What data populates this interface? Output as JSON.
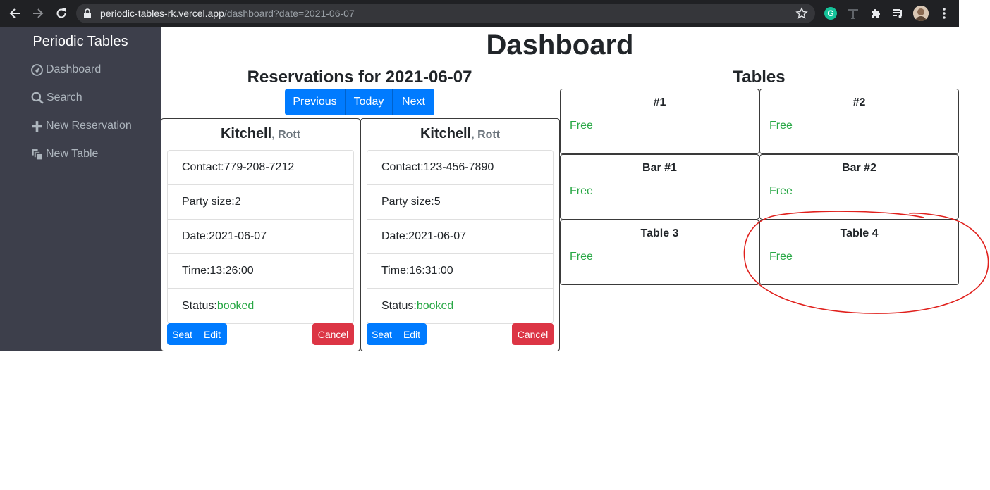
{
  "browser": {
    "url_host": "periodic-tables-rk.vercel.app",
    "url_path": "/dashboard?date=2021-06-07",
    "grammarly_letter": "G"
  },
  "sidebar": {
    "brand": "Periodic Tables",
    "items": [
      {
        "label": "Dashboard",
        "icon": "dashboard-icon"
      },
      {
        "label": "Search",
        "icon": "search-icon"
      },
      {
        "label": "New Reservation",
        "icon": "plus-icon"
      },
      {
        "label": "New Table",
        "icon": "layers-icon"
      }
    ]
  },
  "main": {
    "title": "Dashboard",
    "reservations_heading": "Reservations for 2021-06-07",
    "tables_heading": "Tables",
    "date_nav": {
      "previous": "Previous",
      "today": "Today",
      "next": "Next"
    }
  },
  "reservations": [
    {
      "last_name": "Kitchell",
      "separator": ", ",
      "first_name": "Rott",
      "contact_label": "Contact: ",
      "contact": "779-208-7212",
      "party_label": "Party size: ",
      "party_size": "2",
      "date_label": "Date: ",
      "date": "2021-06-07",
      "time_label": "Time: ",
      "time": "13:26:00",
      "status_label": "Status: ",
      "status": "booked",
      "seat": "Seat",
      "edit": "Edit",
      "cancel": "Cancel"
    },
    {
      "last_name": "Kitchell",
      "separator": ", ",
      "first_name": "Rott",
      "contact_label": "Contact: ",
      "contact": "123-456-7890",
      "party_label": "Party size: ",
      "party_size": "5",
      "date_label": "Date: ",
      "date": "2021-06-07",
      "time_label": "Time: ",
      "time": "16:31:00",
      "status_label": "Status: ",
      "status": "booked",
      "seat": "Seat",
      "edit": "Edit",
      "cancel": "Cancel"
    }
  ],
  "tables": [
    {
      "name": "#1",
      "status": "Free"
    },
    {
      "name": "#2",
      "status": "Free"
    },
    {
      "name": "Bar #1",
      "status": "Free"
    },
    {
      "name": "Bar #2",
      "status": "Free"
    },
    {
      "name": "Table 3",
      "status": "Free"
    },
    {
      "name": "Table 4",
      "status": "Free"
    }
  ],
  "colors": {
    "primary": "#007bff",
    "danger": "#dc3545",
    "success": "#28a745",
    "sidebar": "#3d3f4b",
    "annotation": "#e0201c"
  }
}
